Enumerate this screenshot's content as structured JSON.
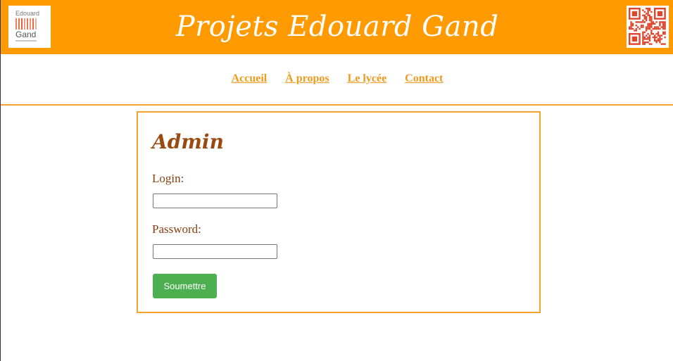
{
  "header": {
    "title": "Projets Edouard Gand",
    "logo": {
      "line1": "Edouard",
      "line2": "Gand",
      "bar_colors": [
        "#f08060",
        "#e8704c",
        "#e06040",
        "#f0a080",
        "#e87858",
        "#f09070",
        "#e86848",
        "#f0b090"
      ]
    },
    "qr_icon": "qr-code-icon"
  },
  "nav": {
    "items": [
      {
        "label": "Accueil"
      },
      {
        "label": "À propos"
      },
      {
        "label": "Le lycée"
      },
      {
        "label": "Contact"
      }
    ]
  },
  "admin": {
    "title": "Admin",
    "login_label": "Login:",
    "login_value": "",
    "password_label": "Password:",
    "password_value": "",
    "submit_label": "Soumettre"
  },
  "colors": {
    "header_bg": "#ff9a00",
    "nav_link": "#ee9a1c",
    "panel_border": "#f4a12e",
    "label_text": "#8a3f10",
    "submit_bg": "#4caf50"
  }
}
